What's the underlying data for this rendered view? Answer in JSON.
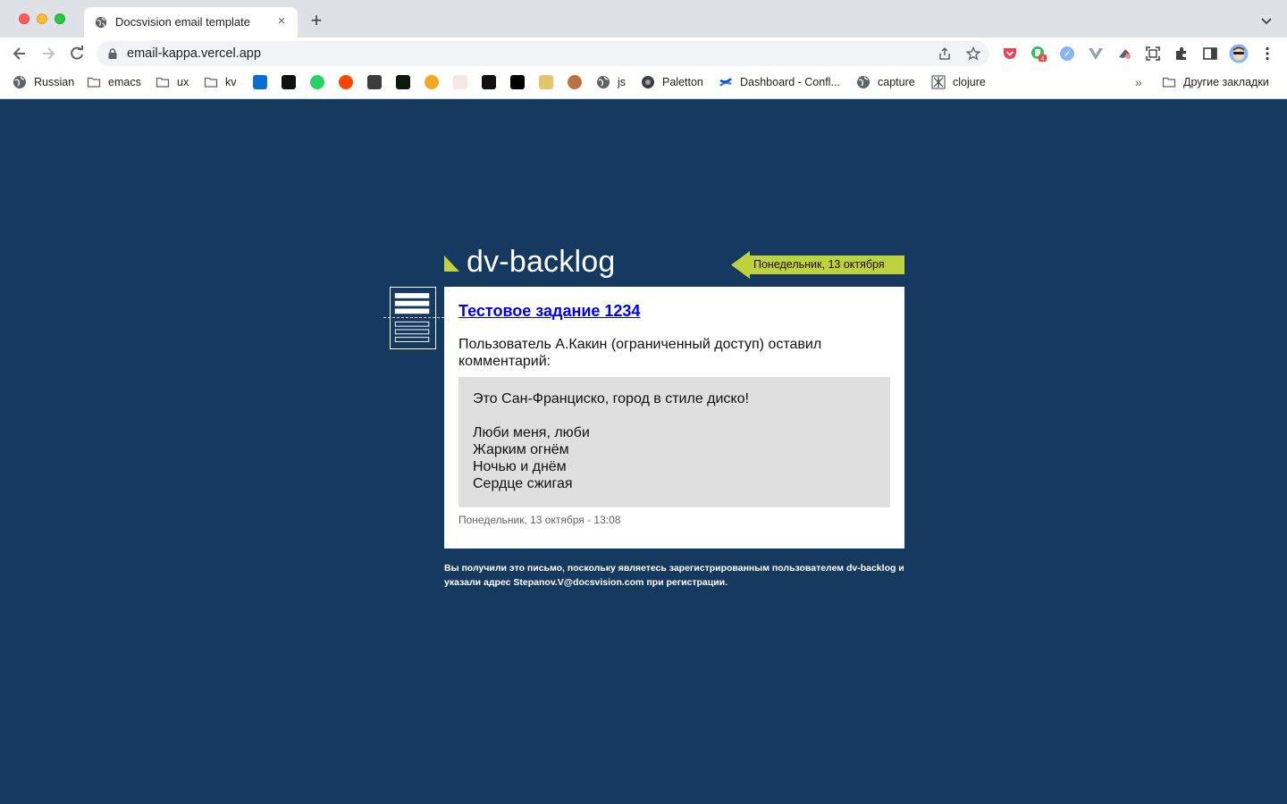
{
  "browser": {
    "tab_title": "Docsvision email template",
    "new_tab_symbol": "+",
    "tab_close_symbol": "×",
    "url": "email-kappa.vercel.app",
    "bookmarks": {
      "russian": "Russian",
      "emacs": "emacs",
      "ux": "ux",
      "kv": "kv",
      "js": "js",
      "paletton": "Paletton",
      "dashboard": "Dashboard - Confl...",
      "capture": "capture",
      "clojure": "clojure",
      "overflow": "»",
      "other": "Другие закладки"
    },
    "extension_badge": "4"
  },
  "email": {
    "logo": "dv-backlog",
    "date_tag": "Понедельник, 13 октября",
    "task_title": "Тестовое задание 1234",
    "author_line": "Пользователь А.Какин (ограниченный доступ) оставил комментарий:",
    "comment_lines": [
      "Это Сан-Франциско, город в стиле диско!",
      "Люби меня, люби",
      "Жарким огнём",
      "Ночью и днём",
      "Сердце сжигая"
    ],
    "timestamp": "Понедельник, 13 октября - 13:08",
    "footer": "Вы получили это письмо, поскольку являетесь зарегистрированным пользователем dv-backlog и указали адрес Stepanov.V@docsvision.com при регистрации."
  },
  "colors": {
    "page_background": "#163a5f",
    "accent_lime": "#bfd23e",
    "link": "#0000ee",
    "quote_background": "#dfdfdf"
  }
}
